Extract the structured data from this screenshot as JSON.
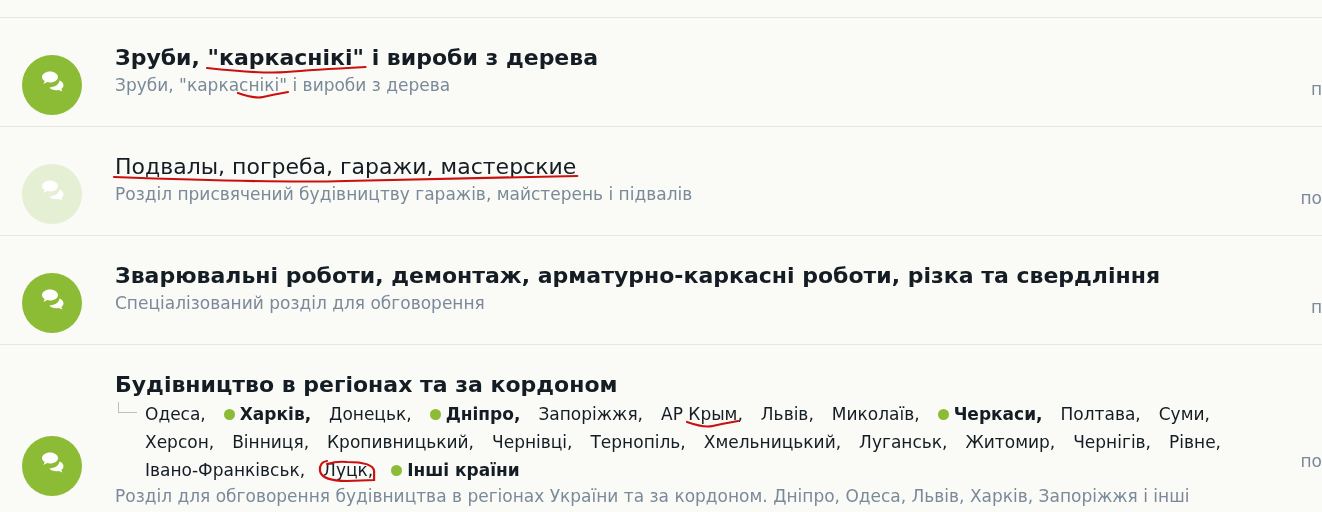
{
  "forums": [
    {
      "unread": true,
      "title": [
        {
          "text": "Зруби, ",
          "kind": "plain"
        },
        {
          "text": "\"каркаснікі\"",
          "kind": "underlined"
        },
        {
          "text": " і вироби з дерева",
          "kind": "plain"
        }
      ],
      "description": [
        {
          "text": "Зруби, \"карка",
          "kind": "plain"
        },
        {
          "text": "снікі\"",
          "kind": "underlined"
        },
        {
          "text": " і вироби з дерева",
          "kind": "plain"
        }
      ],
      "side_text": "п"
    },
    {
      "unread": false,
      "title": [
        {
          "text": "Подвалы, погреба, гаражи, мастерские",
          "kind": "underlined"
        }
      ],
      "description": [
        {
          "text": "Розділ присвячений будівництву гаражів, майстерень і підвалів",
          "kind": "plain"
        }
      ],
      "side_text": "по"
    },
    {
      "unread": true,
      "title": [
        {
          "text": "Зварювальні роботи, демонтаж, арматурно-каркасні роботи, різка та свердління",
          "kind": "plain"
        }
      ],
      "description": [
        {
          "text": "Спеціалізований розділ для обговорення",
          "kind": "plain"
        }
      ],
      "side_text": "п"
    },
    {
      "unread": true,
      "title": [
        {
          "text": "Будівництво в регіонах та за кордоном",
          "kind": "plain"
        }
      ],
      "subforums": [
        {
          "label": [
            {
              "text": "Одеса,",
              "kind": "plain"
            }
          ],
          "unread": false
        },
        {
          "label": [
            {
              "text": "Харків,",
              "kind": "plain"
            }
          ],
          "unread": true
        },
        {
          "label": [
            {
              "text": "Донецьк,",
              "kind": "plain"
            }
          ],
          "unread": false
        },
        {
          "label": [
            {
              "text": "Дніпро,",
              "kind": "plain"
            }
          ],
          "unread": true
        },
        {
          "label": [
            {
              "text": "Запоріжжя,",
              "kind": "plain"
            }
          ],
          "unread": false
        },
        {
          "label": [
            {
              "text": "АР ",
              "kind": "plain"
            },
            {
              "text": "Крым",
              "kind": "underlined"
            },
            {
              "text": ",",
              "kind": "plain"
            }
          ],
          "unread": false
        },
        {
          "label": [
            {
              "text": "Львів,",
              "kind": "plain"
            }
          ],
          "unread": false
        },
        {
          "label": [
            {
              "text": "Миколаїв,",
              "kind": "plain"
            }
          ],
          "unread": false
        },
        {
          "label": [
            {
              "text": "Черкаси,",
              "kind": "plain"
            }
          ],
          "unread": true
        },
        {
          "label": [
            {
              "text": "Полтава,",
              "kind": "plain"
            }
          ],
          "unread": false
        },
        {
          "label": [
            {
              "text": "Суми,",
              "kind": "plain"
            }
          ],
          "unread": false
        },
        {
          "label": [
            {
              "text": "Херсон,",
              "kind": "plain"
            }
          ],
          "unread": false
        },
        {
          "label": [
            {
              "text": "Вінниця,",
              "kind": "plain"
            }
          ],
          "unread": false
        },
        {
          "label": [
            {
              "text": "Кропивницький,",
              "kind": "plain"
            }
          ],
          "unread": false
        },
        {
          "label": [
            {
              "text": "Чернівці,",
              "kind": "plain"
            }
          ],
          "unread": false
        },
        {
          "label": [
            {
              "text": "Тернопіль,",
              "kind": "plain"
            }
          ],
          "unread": false
        },
        {
          "label": [
            {
              "text": "Хмельницький,",
              "kind": "plain"
            }
          ],
          "unread": false
        },
        {
          "label": [
            {
              "text": "Луганськ,",
              "kind": "plain"
            }
          ],
          "unread": false
        },
        {
          "label": [
            {
              "text": "Житомир,",
              "kind": "plain"
            }
          ],
          "unread": false
        },
        {
          "label": [
            {
              "text": "Чернігів,",
              "kind": "plain"
            }
          ],
          "unread": false
        },
        {
          "label": [
            {
              "text": "Рівне,",
              "kind": "plain"
            }
          ],
          "unread": false
        },
        {
          "label": [
            {
              "text": "Івано-Франківськ,",
              "kind": "plain"
            }
          ],
          "unread": false
        },
        {
          "label": [
            {
              "text": "Луцк,",
              "kind": "circled"
            }
          ],
          "unread": false
        },
        {
          "label": [
            {
              "text": "Інші країни",
              "kind": "plain"
            }
          ],
          "unread": true
        }
      ],
      "description": [
        {
          "text": "Розділ для обговорення будівництва в регіонах України та за кордоном. Дніпро, Одеса, Львів, Харків, Запоріжжя і інші",
          "kind": "plain"
        }
      ],
      "side_text": "по"
    }
  ]
}
